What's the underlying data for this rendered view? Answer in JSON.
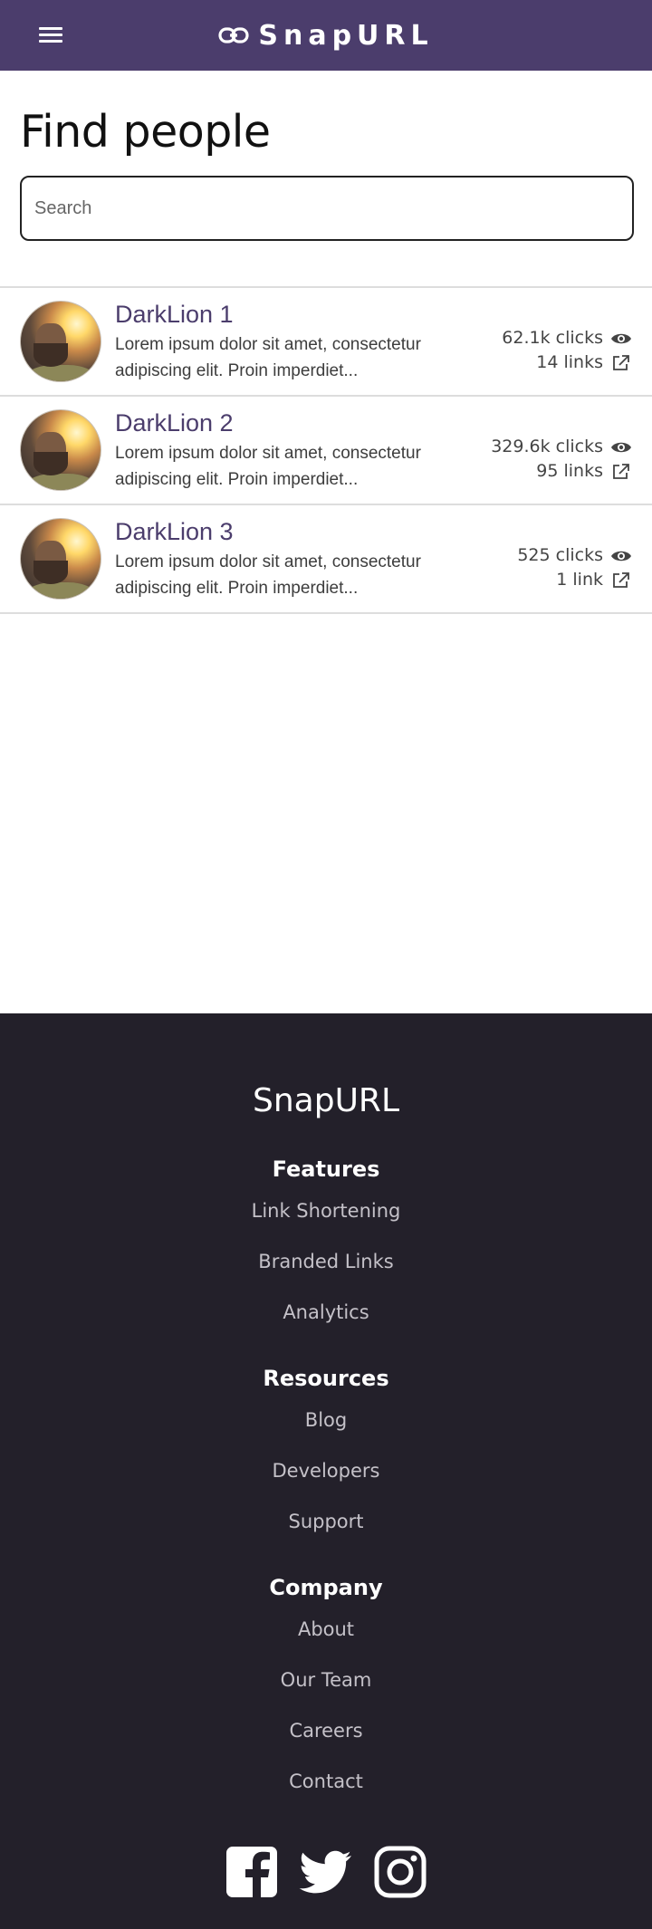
{
  "header": {
    "brand": "SnapURL"
  },
  "main": {
    "title": "Find people",
    "search_placeholder": "Search"
  },
  "people": [
    {
      "name": "DarkLion 1",
      "description": "Lorem ipsum dolor sit amet, consectetur adipiscing elit. Proin imperdiet...",
      "clicks": "62.1k clicks",
      "links": "14 links"
    },
    {
      "name": "DarkLion 2",
      "description": "Lorem ipsum dolor sit amet, consectetur adipiscing elit. Proin imperdiet...",
      "clicks": "329.6k clicks",
      "links": "95 links"
    },
    {
      "name": "DarkLion 3",
      "description": "Lorem ipsum dolor sit amet, consectetur adipiscing elit. Proin imperdiet...",
      "clicks": "525 clicks",
      "links": "1 link"
    }
  ],
  "footer": {
    "brand": "SnapURL",
    "sections": [
      {
        "heading": "Features",
        "links": [
          "Link Shortening",
          "Branded Links",
          "Analytics"
        ]
      },
      {
        "heading": "Resources",
        "links": [
          "Blog",
          "Developers",
          "Support"
        ]
      },
      {
        "heading": "Company",
        "links": [
          "About",
          "Our Team",
          "Careers",
          "Contact"
        ]
      }
    ],
    "social_icons": [
      "facebook-icon",
      "twitter-icon",
      "instagram-icon"
    ]
  },
  "colors": {
    "header_bg": "#4b3d6c",
    "accent": "#4b3d6c",
    "footer_bg": "#23202a"
  }
}
